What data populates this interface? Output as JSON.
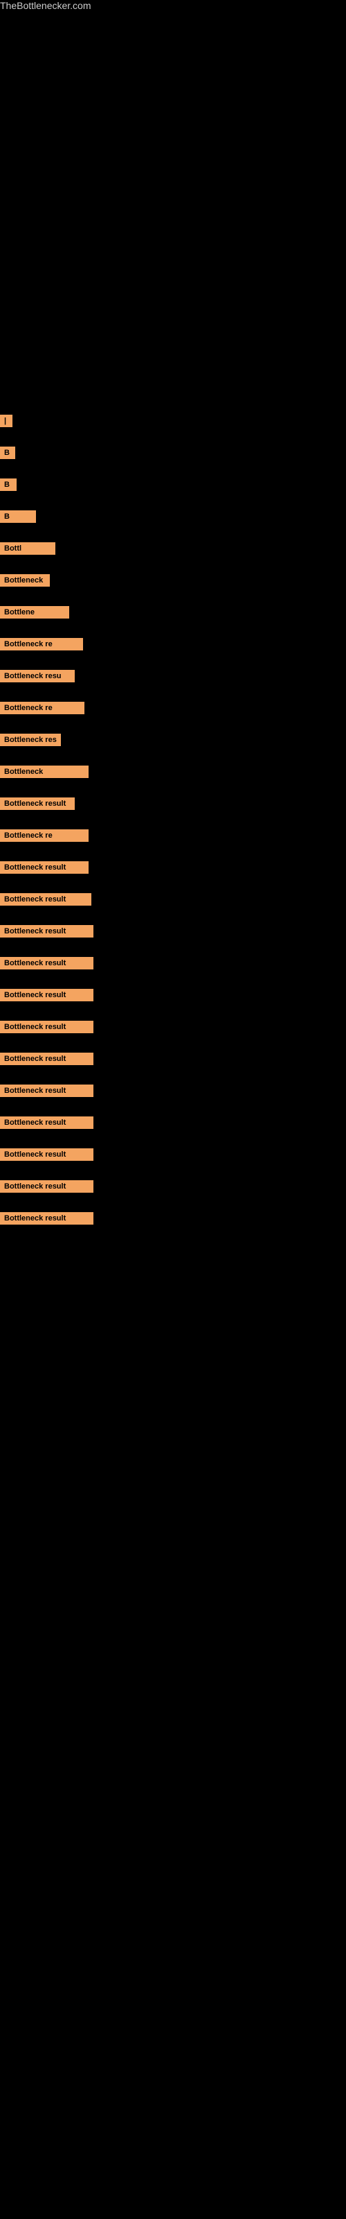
{
  "site": {
    "title": "TheBottlenecker.com"
  },
  "items": [
    {
      "id": 1,
      "label": "|",
      "class": "item-1"
    },
    {
      "id": 2,
      "label": "B",
      "class": "item-2"
    },
    {
      "id": 3,
      "label": "B",
      "class": "item-3"
    },
    {
      "id": 4,
      "label": "B",
      "class": "item-4"
    },
    {
      "id": 5,
      "label": "Bottl",
      "class": "item-5"
    },
    {
      "id": 6,
      "label": "Bottleneck",
      "class": "item-6"
    },
    {
      "id": 7,
      "label": "Bottlene",
      "class": "item-7"
    },
    {
      "id": 8,
      "label": "Bottleneck re",
      "class": "item-8"
    },
    {
      "id": 9,
      "label": "Bottleneck resu",
      "class": "item-9"
    },
    {
      "id": 10,
      "label": "Bottleneck re",
      "class": "item-10"
    },
    {
      "id": 11,
      "label": "Bottleneck res",
      "class": "item-11"
    },
    {
      "id": 12,
      "label": "Bottleneck",
      "class": "item-12"
    },
    {
      "id": 13,
      "label": "Bottleneck result",
      "class": "item-13"
    },
    {
      "id": 14,
      "label": "Bottleneck re",
      "class": "item-14"
    },
    {
      "id": 15,
      "label": "Bottleneck result",
      "class": "item-15"
    },
    {
      "id": 16,
      "label": "Bottleneck result",
      "class": "item-16"
    },
    {
      "id": 17,
      "label": "Bottleneck result",
      "class": "item-17"
    },
    {
      "id": 18,
      "label": "Bottleneck result",
      "class": "item-18"
    },
    {
      "id": 19,
      "label": "Bottleneck result",
      "class": "item-19"
    },
    {
      "id": 20,
      "label": "Bottleneck result",
      "class": "item-20"
    },
    {
      "id": 21,
      "label": "Bottleneck result",
      "class": "item-21"
    },
    {
      "id": 22,
      "label": "Bottleneck result",
      "class": "item-22"
    },
    {
      "id": 23,
      "label": "Bottleneck result",
      "class": "item-23"
    },
    {
      "id": 24,
      "label": "Bottleneck result",
      "class": "item-24"
    },
    {
      "id": 25,
      "label": "Bottleneck result",
      "class": "item-25"
    },
    {
      "id": 26,
      "label": "Bottleneck result",
      "class": "item-26"
    }
  ]
}
